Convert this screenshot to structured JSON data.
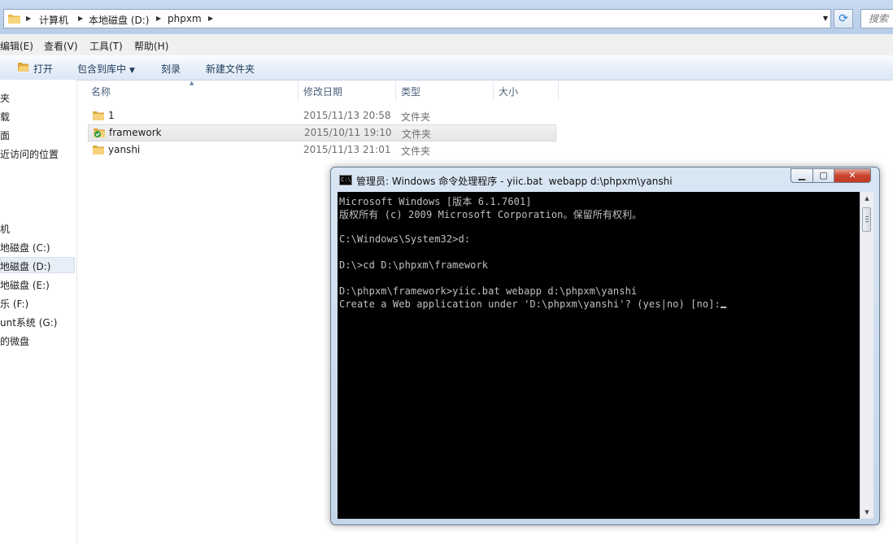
{
  "address": {
    "crumbs": [
      "计算机",
      "本地磁盘 (D:)",
      "phpxm"
    ]
  },
  "search": {
    "placeholder": "搜索"
  },
  "menu": [
    "编辑(E)",
    "查看(V)",
    "工具(T)",
    "帮助(H)"
  ],
  "toolbar": {
    "open": "打开",
    "include_library": "包含到库中",
    "burn": "刻录",
    "new_folder": "新建文件夹"
  },
  "nav": [
    "夹",
    "载",
    "面",
    "近访问的位置",
    "机",
    "地磁盘 (C:)",
    "地磁盘 (D:)",
    "地磁盘 (E:)",
    "乐 (F:)",
    "unt系统 (G:)",
    "的微盘"
  ],
  "columns": {
    "name": "名称",
    "modified": "修改日期",
    "type": "类型",
    "size": "大小"
  },
  "files": [
    {
      "name": "1",
      "modified": "2015/11/13 20:58",
      "type": "文件夹"
    },
    {
      "name": "framework",
      "modified": "2015/10/11 19:10",
      "type": "文件夹"
    },
    {
      "name": "yanshi",
      "modified": "2015/11/13 21:01",
      "type": "文件夹"
    }
  ],
  "cmd": {
    "title": "管理员: Windows 命令处理程序 - yiic.bat  webapp d:\\phpxm\\yanshi",
    "icon_text": "C:\\",
    "lines": [
      "Microsoft Windows [版本 6.1.7601]",
      "版权所有 (c) 2009 Microsoft Corporation。保留所有权利。",
      "",
      "C:\\Windows\\System32>d:",
      "",
      "D:\\>cd D:\\phpxm\\framework",
      "",
      "D:\\phpxm\\framework>yiic.bat webapp d:\\phpxm\\yanshi",
      "Create a Web application under 'D:\\phpxm\\yanshi'? (yes|no) [no]:"
    ]
  }
}
